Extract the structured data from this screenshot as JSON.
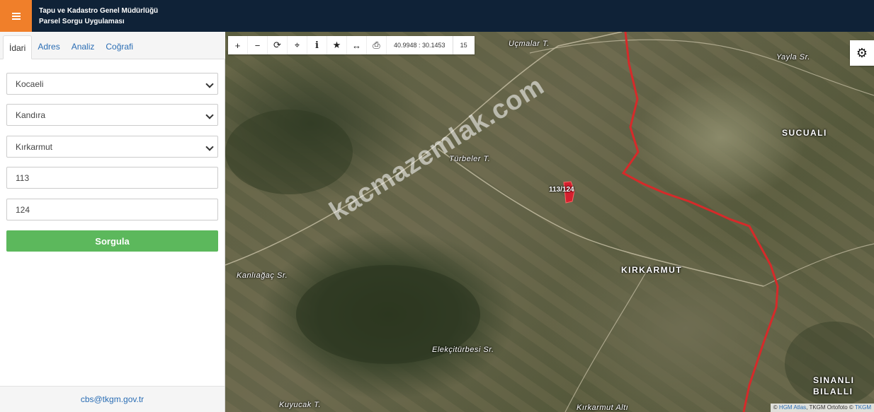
{
  "header": {
    "title_line1": "Tapu ve Kadastro Genel Müdürlüğü",
    "title_line2": "Parsel Sorgu Uygulaması",
    "menu_icon": "hamburger-icon"
  },
  "sidebar": {
    "tabs": [
      {
        "label": "İdari",
        "active": true
      },
      {
        "label": "Adres",
        "active": false
      },
      {
        "label": "Analiz",
        "active": false
      },
      {
        "label": "Coğrafi",
        "active": false
      }
    ],
    "province": "Kocaeli",
    "district": "Kandıra",
    "neighborhood": "Kırkarmut",
    "block": "113",
    "parcel": "124",
    "query_button": "Sorgula",
    "footer_email": "cbs@tkgm.gov.tr"
  },
  "map": {
    "toolbar": {
      "icons": [
        "zoom-in-icon",
        "zoom-out-icon",
        "refresh-icon",
        "locate-icon",
        "info-icon",
        "star-icon",
        "measure-icon",
        "print-icon"
      ],
      "coordinates": "40.9948 : 30.1453",
      "zoom": "15"
    },
    "settings_icon": "gear-icon",
    "labels": {
      "ucmalar": "Uçmalar T.",
      "yayla": "Yayla Sr.",
      "sucuali": "SUCUALI",
      "turbeler": "Türbeler T.",
      "kanliagac": "Kanlıağaç Sr.",
      "kirkarmut": "KIRKARMUT",
      "elekciturbesi": "Elekçitürbesi Sr.",
      "sinanli": "SINANLI",
      "bilalli": "BILALLI",
      "kuyucak": "Kuyucak T.",
      "kirkarmut_alti": "Kırkarmut Altı"
    },
    "parcel_label": "113/124",
    "watermark": "kacmazemlak.com",
    "attribution": {
      "hgm": "HGM Atlas",
      "ortofoto": ", TKGM Ortofoto © ",
      "tkgm": "TKGM"
    },
    "boundary_color": "#d62a2a",
    "parcel_color": "#d41f2e"
  }
}
